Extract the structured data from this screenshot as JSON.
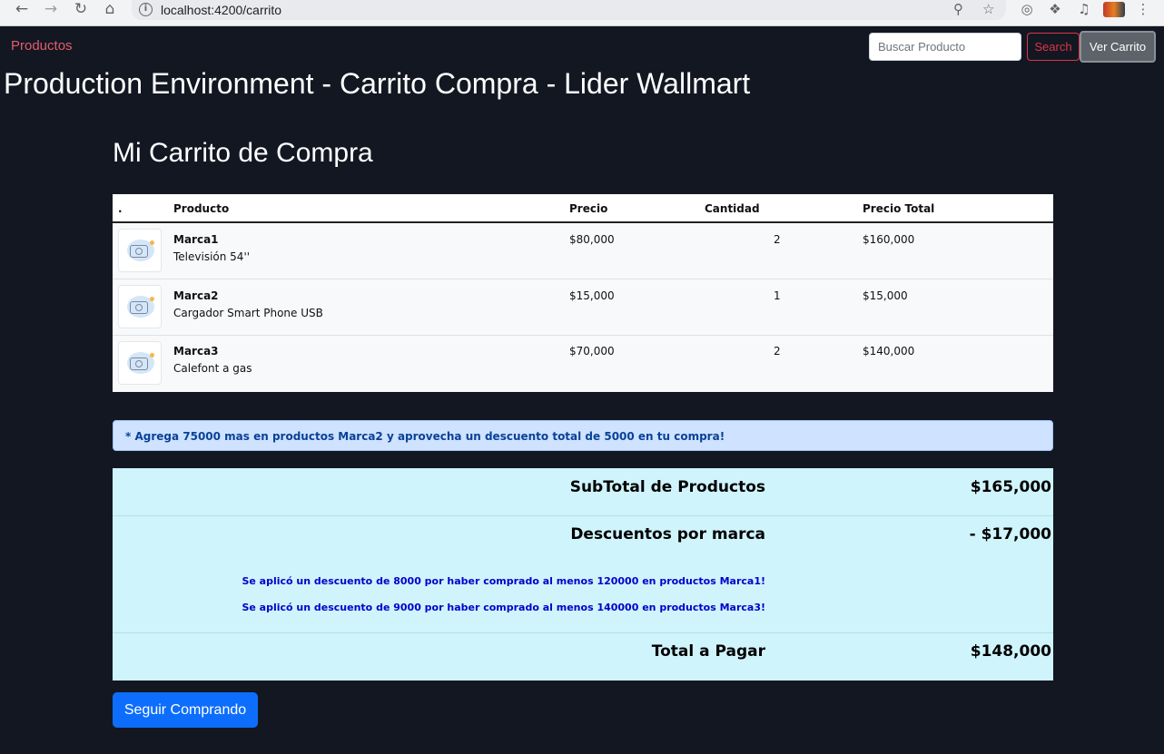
{
  "browser": {
    "url": "localhost:4200/carrito"
  },
  "navbar": {
    "productos_link": "Productos",
    "search_placeholder": "Buscar Producto",
    "search_button": "Search",
    "cart_button": "Ver Carrito"
  },
  "page": {
    "env_title": "Production Environment - Carrito Compra - Lider Wallmart",
    "cart_title": "Mi Carrito de Compra"
  },
  "table": {
    "headers": [
      ".",
      "Producto",
      "Precio",
      "Cantidad",
      "Precio Total"
    ],
    "rows": [
      {
        "brand": "Marca1",
        "description": "Televisión 54''",
        "price": "$80,000",
        "quantity": "2",
        "total": "$160,000"
      },
      {
        "brand": "Marca2",
        "description": "Cargador Smart Phone USB",
        "price": "$15,000",
        "quantity": "1",
        "total": "$15,000"
      },
      {
        "brand": "Marca3",
        "description": "Calefont a gas",
        "price": "$70,000",
        "quantity": "2",
        "total": "$140,000"
      }
    ]
  },
  "alert": {
    "text": "* Agrega 75000 mas en productos Marca2 y aprovecha un descuento total de 5000 en tu compra!"
  },
  "summary": {
    "subtotal_label": "SubTotal de Productos",
    "subtotal_value": "$165,000",
    "discount_label": "Descuentos por marca",
    "discount_value": "- $17,000",
    "discount_notes": [
      "Se aplicó un descuento de 8000 por haber comprado al menos 120000 en productos Marca1!",
      "Se aplicó un descuento de 9000 por haber comprado al menos 140000 en productos Marca3!"
    ],
    "total_label": "Total a Pagar",
    "total_value": "$148,000"
  },
  "actions": {
    "continue_button": "Seguir Comprando"
  },
  "colors": {
    "page_bg": "#131722",
    "link_red": "#e35d6a",
    "primary_blue": "#0d6efd",
    "alert_bg": "#cfe2ff",
    "summary_bg": "#cff4fc"
  }
}
